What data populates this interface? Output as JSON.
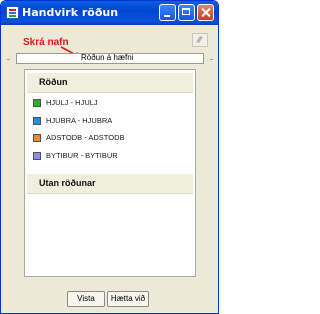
{
  "window": {
    "title": "Handvirk röðun"
  },
  "annotation": {
    "text": "Skrá nafn",
    "color": "#e01818"
  },
  "field": {
    "value": "Röðun á hæfni"
  },
  "sections": {
    "ordered": {
      "title": "Röðun",
      "items": [
        {
          "label": "HJULJ - HJULJ",
          "color": "#22b422"
        },
        {
          "label": "HJUBRA - HJUBRA",
          "color": "#1f8fe0"
        },
        {
          "label": "ADSTODB - ADSTODB",
          "color": "#f08a28"
        },
        {
          "label": "BYTIBUR - BYTIBUR",
          "color": "#8c8cf0"
        }
      ]
    },
    "unordered": {
      "title": "Utan röðunar"
    }
  },
  "buttons": {
    "save": "Vista",
    "cancel": "Hætta við"
  }
}
